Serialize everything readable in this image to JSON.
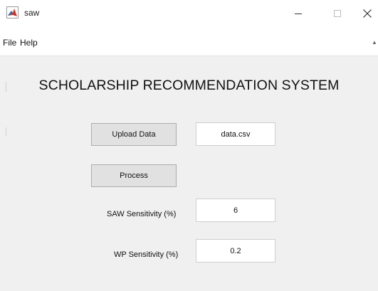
{
  "window": {
    "title": "saw",
    "controls": {
      "minimize_icon": "minimize-icon",
      "maximize_icon": "maximize-icon",
      "close_icon": "close-icon"
    }
  },
  "menu": {
    "items": [
      {
        "label": "File"
      },
      {
        "label": "Help"
      }
    ],
    "overflow_icon": "chevron-up-icon"
  },
  "main": {
    "title": "SCHOLARSHIP RECOMMENDATION SYSTEM",
    "upload_button": "Upload Data",
    "file_value": "data.csv",
    "process_button": "Process",
    "saw_label": "SAW Sensitivity (%)",
    "saw_value": "6",
    "wp_label": "WP Sensitivity (%)",
    "wp_value": "0.2"
  },
  "colors": {
    "background": "#f0f0f0",
    "button": "#e1e1e1",
    "button_border": "#adadad",
    "icon_red": "#d62e1f"
  }
}
